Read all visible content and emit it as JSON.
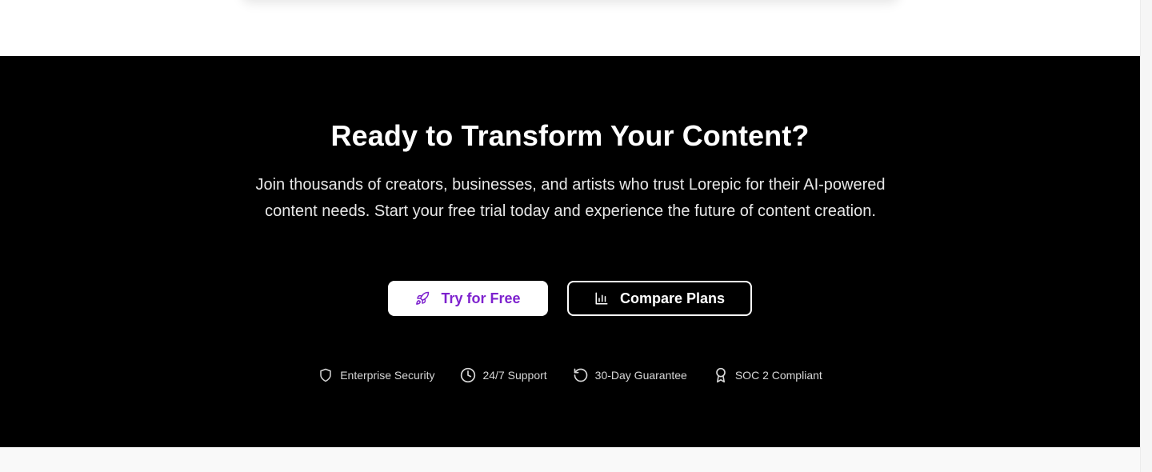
{
  "cta": {
    "title": "Ready to Transform Your Content?",
    "description": "Join thousands of creators, businesses, and artists who trust Lorepic for their AI-powered content needs. Start your free trial today and experience the future of content creation.",
    "primary_button": {
      "label": "Try for Free",
      "icon": "rocket-icon"
    },
    "secondary_button": {
      "label": "Compare Plans",
      "icon": "bar-chart-icon"
    },
    "badges": [
      {
        "label": "Enterprise Security",
        "icon": "shield-icon"
      },
      {
        "label": "24/7 Support",
        "icon": "clock-icon"
      },
      {
        "label": "30-Day Guarantee",
        "icon": "rotate-ccw-icon"
      },
      {
        "label": "SOC 2 Compliant",
        "icon": "award-icon"
      }
    ]
  },
  "colors": {
    "section_bg": "#000000",
    "accent": "#7e22ce",
    "text": "#ffffff"
  }
}
